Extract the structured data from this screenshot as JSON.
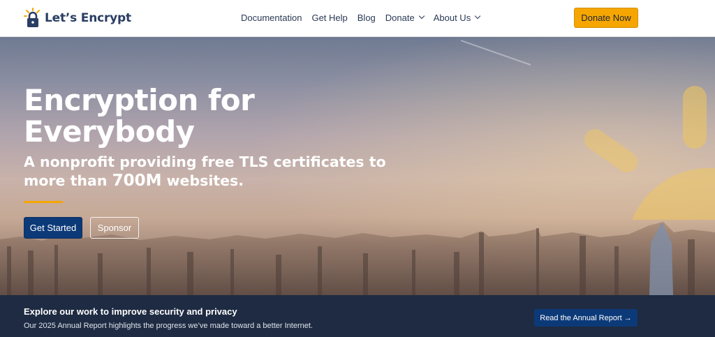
{
  "brand": {
    "name": "Let’s Encrypt"
  },
  "nav": {
    "items": [
      {
        "label": "Documentation",
        "dropdown": false
      },
      {
        "label": "Get Help",
        "dropdown": false
      },
      {
        "label": "Blog",
        "dropdown": false
      },
      {
        "label": "Donate",
        "dropdown": true
      },
      {
        "label": "About Us",
        "dropdown": true
      }
    ],
    "donate_button": "Donate Now"
  },
  "hero": {
    "title": "Encryption for Everybody",
    "subtitle_prefix": "A nonprofit providing free TLS certificates to more than ",
    "subtitle_highlight": "700M",
    "subtitle_suffix": " websites.",
    "primary_button": "Get Started",
    "secondary_button": "Sponsor"
  },
  "banner": {
    "title": "Explore our work to improve security and privacy",
    "text": "Our 2025 Annual Report highlights the progress we’ve made toward a better Internet.",
    "button": "Read the Annual Report →"
  },
  "colors": {
    "brand_navy": "#2a3d63",
    "accent_orange": "#f6a600",
    "button_blue": "#0c3a78",
    "banner_bg": "#1e2b42"
  }
}
